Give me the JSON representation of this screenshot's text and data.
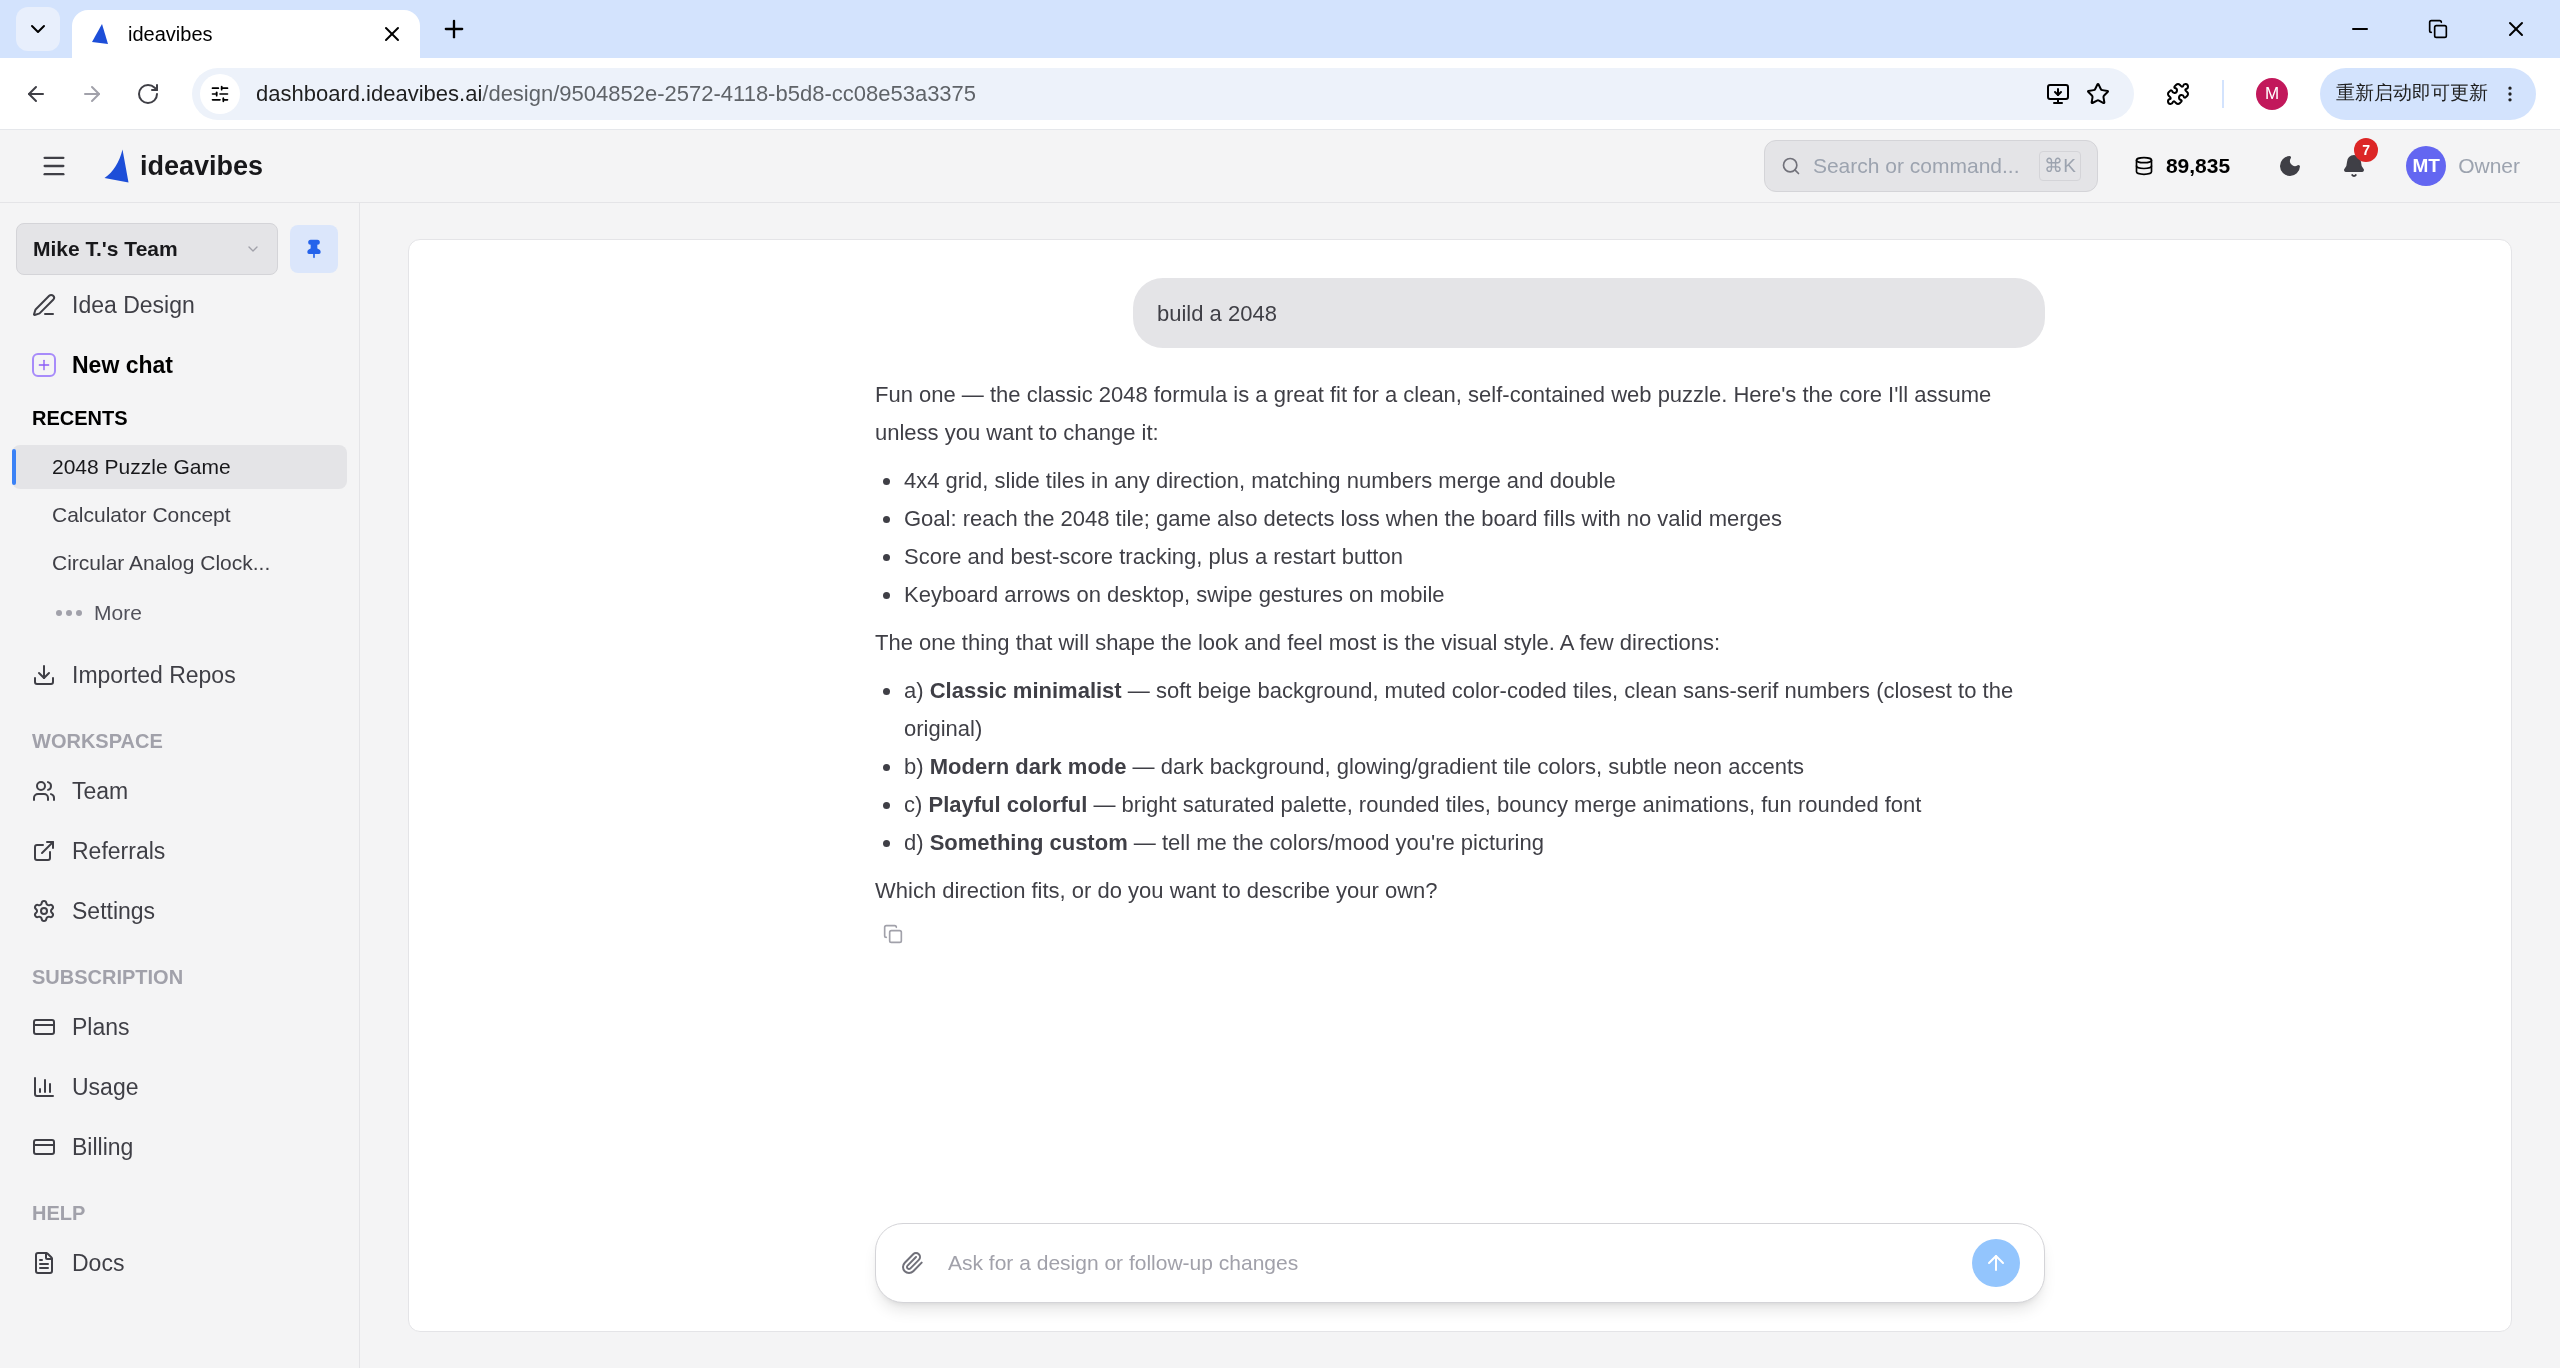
{
  "browser": {
    "tab_title": "ideavibes",
    "url_host": "dashboard.ideavibes.ai",
    "url_path": "/design/9504852e-2572-4118-b5d8-cc08e53a3375",
    "profile_initial": "M",
    "update_label": "重新启动即可更新"
  },
  "header": {
    "brand": "ideavibes",
    "search_placeholder": "Search or command...",
    "shortcut": "⌘K",
    "credits": "89,835",
    "notification_count": "7",
    "avatar_initials": "MT",
    "role": "Owner"
  },
  "sidebar": {
    "team": "Mike T.'s Team",
    "top_items": [
      {
        "kind": "design",
        "label": "Idea Design"
      },
      {
        "kind": "new",
        "label": "New chat"
      }
    ],
    "recents_title": "RECENTS",
    "recents": [
      {
        "label": "2048 Puzzle Game",
        "selected": true
      },
      {
        "label": "Calculator Concept",
        "selected": false
      },
      {
        "label": "Circular Analog Clock...",
        "selected": false
      }
    ],
    "more": "More",
    "imported": {
      "kind": "import",
      "label": "Imported Repos"
    },
    "sections": [
      {
        "title": "WORKSPACE",
        "items": [
          {
            "kind": "team",
            "label": "Team"
          },
          {
            "kind": "link",
            "label": "Referrals"
          },
          {
            "kind": "settings",
            "label": "Settings"
          }
        ]
      },
      {
        "title": "SUBSCRIPTION",
        "items": [
          {
            "kind": "card",
            "label": "Plans"
          },
          {
            "kind": "chart",
            "label": "Usage"
          },
          {
            "kind": "card",
            "label": "Billing"
          }
        ]
      },
      {
        "title": "HELP",
        "items": [
          {
            "kind": "doc",
            "label": "Docs"
          }
        ]
      }
    ]
  },
  "chat": {
    "user_message": "build a 2048",
    "reply": [
      {
        "kind": "paragraph",
        "text": "Fun one — the classic 2048 formula is a great fit for a clean, self-contained web puzzle. Here's the core I'll assume unless you want to change it:"
      },
      {
        "kind": "list",
        "items": [
          "4x4 grid, slide tiles in any direction, matching numbers merge and double",
          "Goal: reach the 2048 tile; game also detects loss when the board fills with no valid merges",
          "Score and best-score tracking, plus a restart button",
          "Keyboard arrows on desktop, swipe gestures on mobile"
        ]
      },
      {
        "kind": "paragraph",
        "text": "The one thing that will shape the look and feel most is the visual style. A few directions:"
      },
      {
        "kind": "list",
        "items": [
          "a) **Classic minimalist** — soft beige background, muted color-coded tiles, clean sans-serif numbers (closest to the original)",
          "b) **Modern dark mode** — dark background, glowing/gradient tile colors, subtle neon accents",
          "c) **Playful colorful** — bright saturated palette, rounded tiles, bouncy merge animations, fun rounded font",
          "d) **Something custom** — tell me the colors/mood you're picturing"
        ]
      },
      {
        "kind": "paragraph",
        "text": "Which direction fits, or do you want to describe your own?"
      }
    ],
    "input_placeholder": "Ask for a design or follow-up changes"
  }
}
